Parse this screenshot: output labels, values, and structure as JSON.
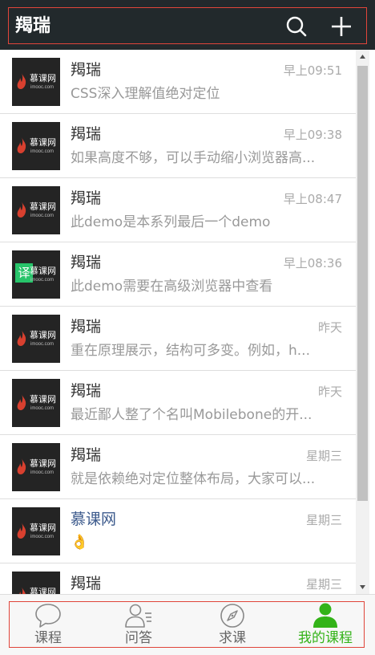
{
  "header": {
    "title": "羯瑞",
    "search_icon": "search-icon",
    "add_icon": "plus-icon",
    "accent": "#e0453a"
  },
  "messages": [
    {
      "name": "羯瑞",
      "time": "早上09:51",
      "preview": "CSS深入理解值绝对定位",
      "avatar": "imooc-logo"
    },
    {
      "name": "羯瑞",
      "time": "早上09:38",
      "preview": "如果高度不够，可以手动缩小浏览器高...",
      "avatar": "imooc-logo"
    },
    {
      "name": "羯瑞",
      "time": "早上08:47",
      "preview": "此demo是本系列最后一个demo",
      "avatar": "imooc-logo"
    },
    {
      "name": "羯瑞",
      "time": "早上08:36",
      "preview": "此demo需要在高级浏览器中查看",
      "avatar": "imooc-translate-logo"
    },
    {
      "name": "羯瑞",
      "time": "昨天",
      "preview": "重在原理展示，结构可多变。例如，h...",
      "avatar": "imooc-logo"
    },
    {
      "name": "羯瑞",
      "time": "昨天",
      "preview": "最近鄙人整了个名叫Mobilebone的开...",
      "avatar": "imooc-logo"
    },
    {
      "name": "羯瑞",
      "time": "星期三",
      "preview": "就是依赖绝对定位整体布局，大家可以...",
      "avatar": "imooc-logo"
    },
    {
      "name": "慕课网",
      "time": "星期三",
      "preview": "👌",
      "avatar": "imooc-logo"
    },
    {
      "name": "羯瑞",
      "time": "星期三",
      "preview": "",
      "avatar": "imooc-logo"
    }
  ],
  "avatar_text": {
    "cn": "慕课网",
    "en": "imooc.com",
    "translate": "译"
  },
  "tabs": [
    {
      "label": "课程",
      "icon": "chat-bubble-icon"
    },
    {
      "label": "问答",
      "icon": "contacts-icon"
    },
    {
      "label": "求课",
      "icon": "compass-icon"
    },
    {
      "label": "我的课程",
      "icon": "profile-icon",
      "active": true
    }
  ],
  "colors": {
    "header_bg": "#22292c",
    "active_tab": "#33b318",
    "name_link": "#3c5a8c"
  }
}
